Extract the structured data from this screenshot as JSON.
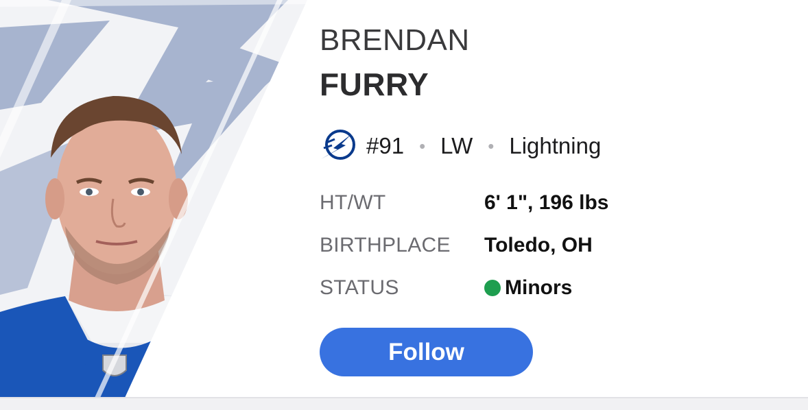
{
  "player": {
    "first_name": "BRENDAN",
    "last_name": "FURRY",
    "number": "#91",
    "position": "LW",
    "team": "Lightning",
    "team_logo_icon": "tampa-bay-lightning-logo",
    "separator": "•"
  },
  "attributes": [
    {
      "label": "HT/WT",
      "value": "6' 1\", 196 lbs"
    },
    {
      "label": "BIRTHPLACE",
      "value": "Toledo, OH"
    },
    {
      "label": "STATUS",
      "value": "Minors"
    }
  ],
  "status_color": "#1e9e4f",
  "follow": {
    "label": "Follow",
    "color": "#3872e0"
  },
  "colors": {
    "team_blue": "#0a3a8c",
    "hero_bolt": "#a7b4cf",
    "hero_bg": "#f2f3f6"
  }
}
